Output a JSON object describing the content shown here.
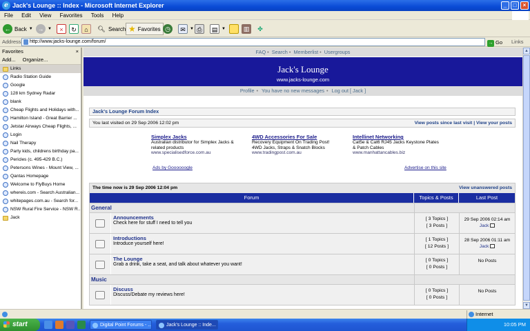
{
  "window": {
    "title": "Jack's Lounge :: Index - Microsoft Internet Explorer"
  },
  "menu": [
    "File",
    "Edit",
    "View",
    "Favorites",
    "Tools",
    "Help"
  ],
  "toolbar": {
    "back": "Back",
    "search": "Search",
    "favorites": "Favorites"
  },
  "address": {
    "label": "Address",
    "url": "http://www.jacks-lounge.com/forum/",
    "go": "Go",
    "links": "Links"
  },
  "favorites": {
    "title": "Favorites",
    "add": "Add...",
    "organize": "Organize...",
    "items": [
      {
        "label": "Links",
        "type": "folder"
      },
      {
        "label": "Radio Station Guide",
        "type": "link"
      },
      {
        "label": "Google",
        "type": "link"
      },
      {
        "label": "128 km Sydney Radar",
        "type": "link"
      },
      {
        "label": "blank",
        "type": "link"
      },
      {
        "label": "Cheap Flights and Holidays with...",
        "type": "link"
      },
      {
        "label": "Hamilton Island - Great Barrier ...",
        "type": "link"
      },
      {
        "label": "Jetstar Airways Cheap Flights, ...",
        "type": "link"
      },
      {
        "label": "Login",
        "type": "link"
      },
      {
        "label": "Nail Therapy",
        "type": "link"
      },
      {
        "label": "Party kids, childrens birthday pa...",
        "type": "link"
      },
      {
        "label": "Pericles (c. 495-429 B.C.)",
        "type": "link"
      },
      {
        "label": "Petersons Wines - Mount View, ...",
        "type": "link"
      },
      {
        "label": "Qantas Homepage",
        "type": "link"
      },
      {
        "label": "Welcome to FlyBuys  Home",
        "type": "link"
      },
      {
        "label": "whereis.com - Search Australian...",
        "type": "link"
      },
      {
        "label": "whitepages.com.au - Search for...",
        "type": "link"
      },
      {
        "label": "NSW Rural Fire Service - NSW R...",
        "type": "link"
      },
      {
        "label": "Jack",
        "type": "folder"
      }
    ]
  },
  "site": {
    "topnav": [
      "FAQ",
      "Search",
      "Memberlist",
      "Usergroups"
    ],
    "title": "Jack's Lounge",
    "url": "www.jacks-lounge.com",
    "subnav": [
      "Profile",
      "You have no new messages",
      "Log out [ Jack ]"
    ],
    "index_title": "Jack's Lounge Forum Index",
    "last_visit": "You last visited on 29 Sep 2006 12:02 pm",
    "view_since": "View posts since last visit",
    "view_yours": "View your posts",
    "ads": [
      {
        "title": "Simplex Jacks",
        "line1": "Australian distributor for Simplex Jacks &",
        "line2": "related products",
        "url": "www.specialisedforce.com.au"
      },
      {
        "title": "4WD Accessories For Sale",
        "line1": "Recovery Equipment On Trading Post!",
        "line2": "4WD Jacks, Straps & Snatch Blocks",
        "url": "www.tradingpost.com.au"
      },
      {
        "title": "Intellinet Networking",
        "line1": "Cat5e & Cat6 RJ45 Jacks Keystone Plates",
        "line2": "& Patch Cables",
        "url": "www.manhattancables.biz"
      }
    ],
    "ads_by": "Ads by Goooooogle",
    "advertise": "Advertise on this site",
    "time_now": "The time now is 29 Sep 2006 12:04 pm",
    "view_unanswered": "View unanswered posts",
    "col_forum": "Forum",
    "col_topics": "Topics & Posts",
    "col_last": "Last Post",
    "categories": [
      {
        "name": "General",
        "forums": [
          {
            "name": "Announcements",
            "desc": "Check here for stuff I need to tell you",
            "topics": "[ 3 Topics ]",
            "posts": "[ 3 Posts ]",
            "last_date": "29 Sep 2006 02:14 am",
            "last_user": "Jack"
          },
          {
            "name": "Introductions",
            "desc": "Introduce yourself here!",
            "topics": "[ 1 Topics ]",
            "posts": "[ 12 Posts ]",
            "last_date": "28 Sep 2006 01:11 am",
            "last_user": "Jack"
          },
          {
            "name": "The Lounge",
            "desc": "Grab a drink, take a seat, and talk about whatever you want!",
            "topics": "[ 0 Topics ]",
            "posts": "[ 0 Posts ]",
            "last_date": "No Posts",
            "last_user": ""
          }
        ]
      },
      {
        "name": "Music",
        "forums": [
          {
            "name": "Discuss",
            "desc": "Discuss/Debate my reviews here!",
            "topics": "[ 0 Topics ]",
            "posts": "[ 0 Posts ]",
            "last_date": "No Posts",
            "last_user": ""
          }
        ]
      }
    ]
  },
  "status": {
    "zone": "Internet"
  },
  "taskbar": {
    "start": "start",
    "tasks": [
      "Digital Point Forums - ...",
      "Jack's Lounge :: Inde..."
    ],
    "clock": "10:05 PM"
  }
}
